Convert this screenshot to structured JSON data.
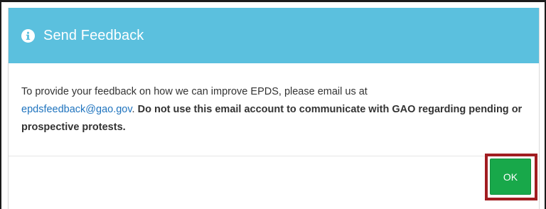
{
  "dialog": {
    "title": "Send Feedback",
    "title_icon": "info-circle-icon",
    "message_prefix": "To provide your feedback on how we can improve EPDS, please email us at",
    "email": "epdsfeedback@gao.gov",
    "message_punctuation": ".",
    "warning": "Do not use this email account to communicate with GAO regarding pending or prospective protests.",
    "ok_label": "OK"
  },
  "colors": {
    "header_background": "#5bc0de",
    "link": "#1e73be",
    "ok_button": "#18a84a",
    "highlight_border": "#a11d21"
  }
}
